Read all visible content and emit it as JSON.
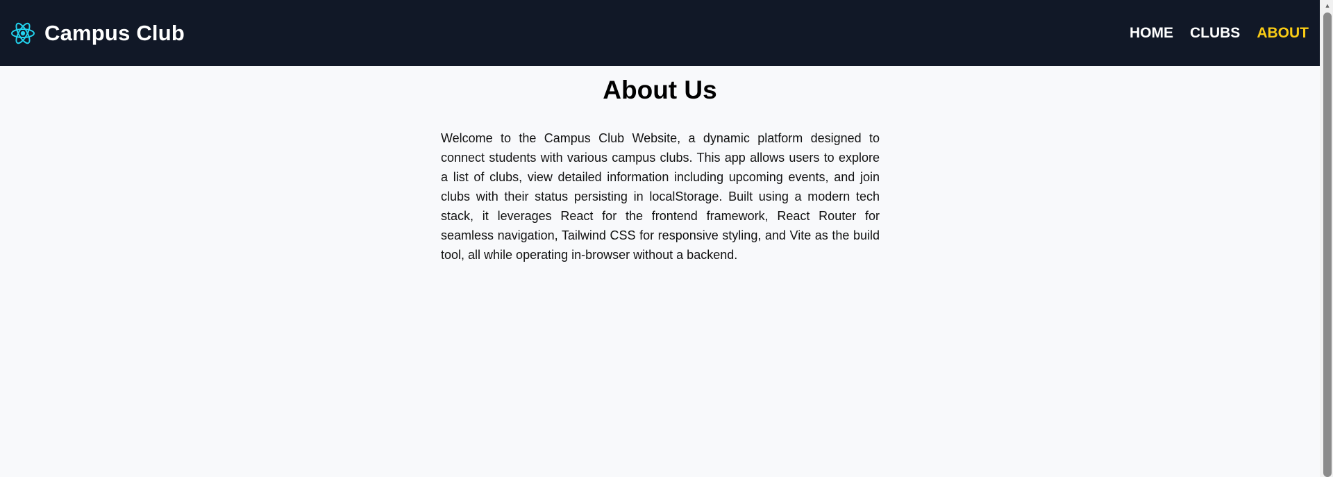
{
  "navbar": {
    "logo_icon": "react-atom-icon",
    "title": "Campus Club",
    "links": [
      {
        "label": "HOME",
        "active": false
      },
      {
        "label": "CLUBS",
        "active": false
      },
      {
        "label": "ABOUT",
        "active": true
      }
    ]
  },
  "about": {
    "heading": "About Us",
    "body": "Welcome to the Campus Club Website, a dynamic platform designed to connect students with various campus clubs. This app allows users to explore a list of clubs, view detailed information including upcoming events, and join clubs with their status persisting in localStorage. Built using a modern tech stack, it leverages React for the frontend framework, React Router for seamless navigation, Tailwind CSS for responsive styling, and Vite as the build tool, all while operating in-browser without a backend."
  },
  "colors": {
    "navbar_bg": "#111827",
    "page_bg": "#f8f9fb",
    "active_link": "#facc15",
    "logo_accent": "#22d3ee"
  }
}
